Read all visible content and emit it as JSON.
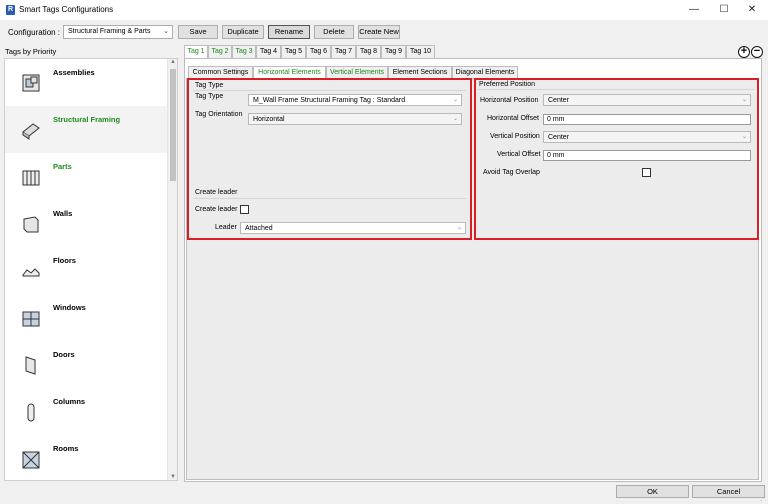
{
  "window": {
    "title": "Smart Tags Configurations",
    "app_icon": "R",
    "controls": {
      "minimize": "—",
      "maximize": "☐",
      "close": "✕"
    }
  },
  "toolbar": {
    "configuration_label": "Configuration :",
    "configuration_value": "Structural Framing & Parts",
    "save": "Save",
    "duplicate": "Duplicate",
    "rename": "Rename",
    "delete": "Delete",
    "create_new": "Create New"
  },
  "sidebar": {
    "title": "Tags by Priority",
    "items": [
      {
        "label": "Assemblies",
        "icon": "assemblies-icon"
      },
      {
        "label": "Structural Framing",
        "icon": "structural-framing-icon"
      },
      {
        "label": "Parts",
        "icon": "parts-icon"
      },
      {
        "label": "Walls",
        "icon": "walls-icon"
      },
      {
        "label": "Floors",
        "icon": "floors-icon"
      },
      {
        "label": "Windows",
        "icon": "windows-icon"
      },
      {
        "label": "Doors",
        "icon": "doors-icon"
      },
      {
        "label": "Columns",
        "icon": "columns-icon"
      },
      {
        "label": "Rooms",
        "icon": "rooms-icon"
      }
    ]
  },
  "tag_tabs": [
    "Tag 1",
    "Tag 2",
    "Tag 3",
    "Tag 4",
    "Tag 5",
    "Tag 6",
    "Tag 7",
    "Tag 8",
    "Tag 9",
    "Tag 10"
  ],
  "add_remove": {
    "add": "+",
    "remove": "−"
  },
  "sub_tabs": [
    "Common Settings",
    "Horizontal Elements",
    "Vertical Elements",
    "Element Sections",
    "Diagonal Elements"
  ],
  "tag_type_group": {
    "title": "Tag Type",
    "tag_type_label": "Tag Type",
    "tag_type_value": "M_Wall Frame Structural Framing Tag : Standard",
    "orientation_label": "Tag Orientation",
    "orientation_value": "Horizontal"
  },
  "leader_group": {
    "title": "Create leader",
    "create_leader_label": "Create leader",
    "create_leader_checked": false,
    "leader_label": "Leader",
    "leader_value": "Attached"
  },
  "position_group": {
    "title": "Preferred Position",
    "h_position_label": "Horizontal Position",
    "h_position_value": "Center",
    "h_offset_label": "Horizontal Offset",
    "h_offset_value": "0 mm",
    "v_position_label": "Vertical Position",
    "v_position_value": "Center",
    "v_offset_label": "Vertical Offset",
    "v_offset_value": "0 mm",
    "avoid_overlap_label": "Avoid Tag Overlap",
    "avoid_overlap_checked": false
  },
  "footer": {
    "ok": "OK",
    "cancel": "Cancel"
  },
  "colors": {
    "accent_green": "#1e8a1e",
    "highlight_red": "#d91f26"
  }
}
